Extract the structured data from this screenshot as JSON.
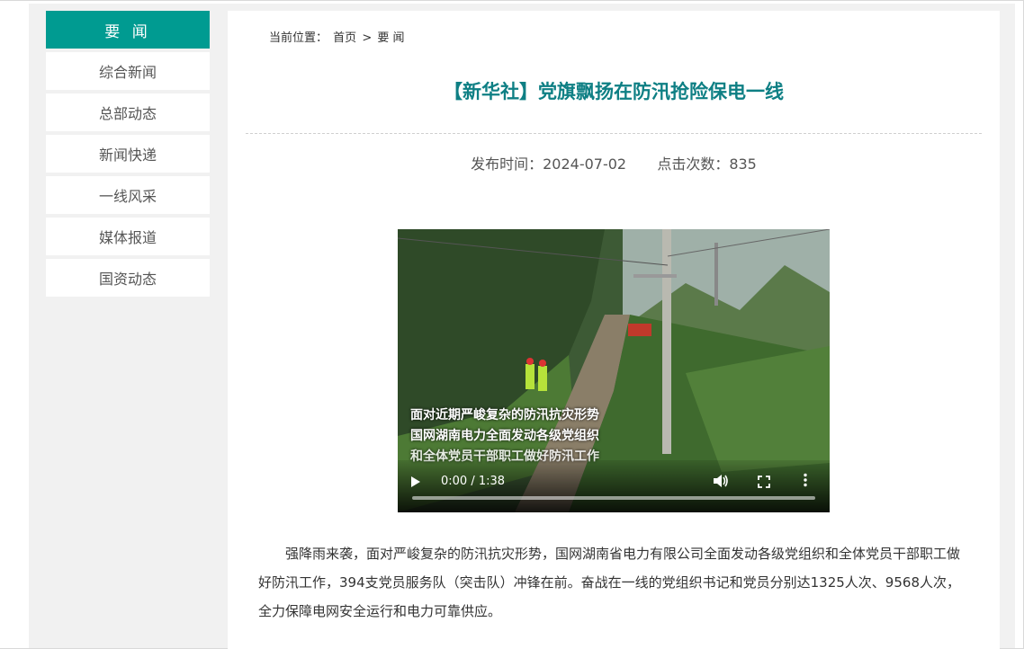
{
  "sidebar": {
    "header": "要 闻",
    "items": [
      {
        "label": "综合新闻"
      },
      {
        "label": "总部动态"
      },
      {
        "label": "新闻快递"
      },
      {
        "label": "一线风采"
      },
      {
        "label": "媒体报道"
      },
      {
        "label": "国资动态"
      }
    ]
  },
  "breadcrumb": {
    "prefix": "当前位置：",
    "home": "首页",
    "separator": ">",
    "current": "要 闻"
  },
  "article": {
    "title": "【新华社】党旗飘扬在防汛抢险保电一线",
    "publish_label": "发布时间：2024-07-02",
    "views_label": "点击次数：835",
    "body": "强降雨来袭，面对严峻复杂的防汛抗灾形势，国网湖南省电力有限公司全面发动各级党组织和全体党员干部职工做好防汛工作，394支党员服务队（突击队）冲锋在前。奋战在一线的党组织书记和党员分别达1325人次、9568人次，全力保障电网安全运行和电力可靠供应。"
  },
  "video": {
    "captions": [
      "面对近期严峻复杂的防汛抗灾形势",
      "国网湖南电力全面发动各级党组织",
      "和全体党员干部职工做好防汛工作"
    ],
    "time": "0:00 / 1:38",
    "icons": {
      "play": "play-icon",
      "volume": "volume-icon",
      "fullscreen": "fullscreen-icon",
      "more": "more-vertical-icon"
    }
  },
  "colors": {
    "accent": "#009b91",
    "title": "#0e7f84",
    "page_bg": "#f1f1f1"
  }
}
